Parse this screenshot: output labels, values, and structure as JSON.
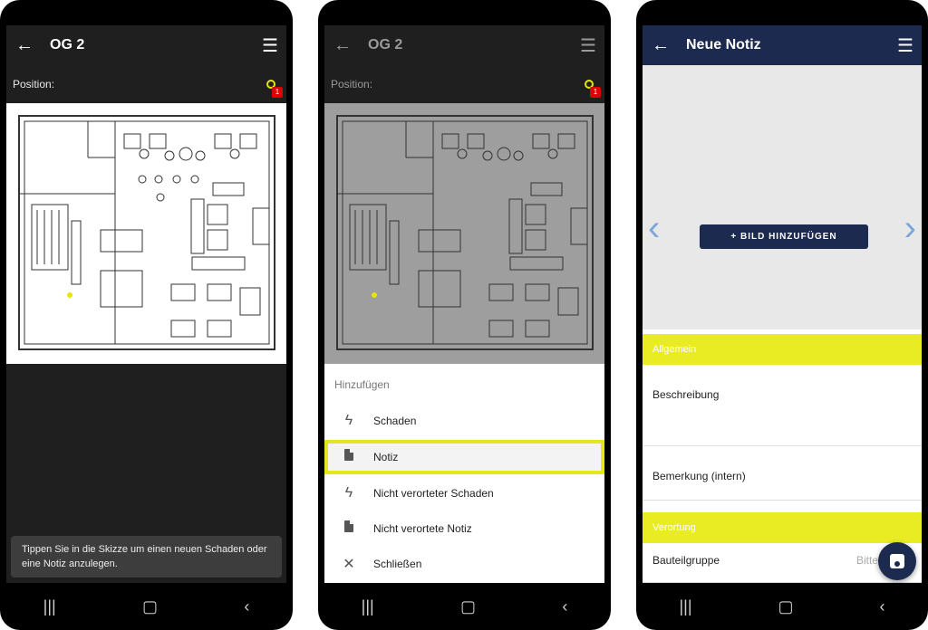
{
  "screen1": {
    "title": "OG 2",
    "position_label": "Position:",
    "marker_badge": "1",
    "toast": "Tippen Sie in die Skizze um einen neuen Schaden oder eine Notiz anzulegen."
  },
  "screen2": {
    "title": "OG 2",
    "position_label": "Position:",
    "marker_badge": "1",
    "sheet_title": "Hinzufügen",
    "options": [
      {
        "label": "Schaden",
        "icon": "bolt-icon"
      },
      {
        "label": "Notiz",
        "icon": "file-icon",
        "highlighted": true
      },
      {
        "label": "Nicht verorteter Schaden",
        "icon": "bolt-icon"
      },
      {
        "label": "Nicht verortete Notiz",
        "icon": "file-icon"
      },
      {
        "label": "Schließen",
        "icon": "close-icon"
      }
    ]
  },
  "screen3": {
    "title": "Neue Notiz",
    "add_image_label": "+ BILD HINZUFÜGEN",
    "section_general": "Allgemein",
    "field_description": "Beschreibung",
    "field_remark": "Bemerkung (intern)",
    "section_location": "Verortung",
    "field_component_group": "Bauteilgruppe",
    "field_component_group_placeholder": "Bitte wähl"
  },
  "colors": {
    "accent_yellow": "#e9ec22",
    "navy": "#1c2a4f",
    "dark_bg": "#1f1f1f",
    "badge_red": "#dd0000"
  }
}
